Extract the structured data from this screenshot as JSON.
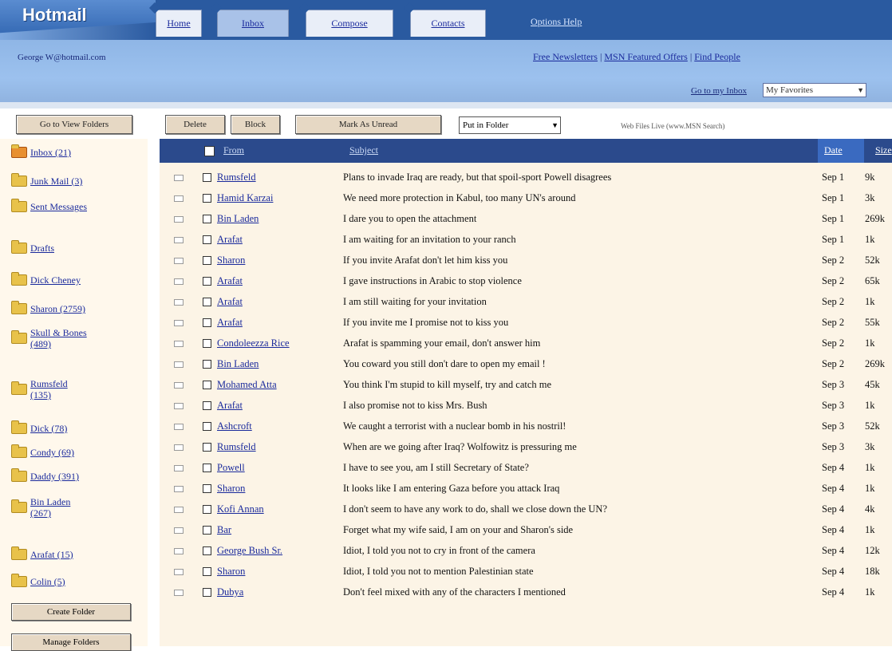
{
  "brand": {
    "logo": "Hotmail"
  },
  "tabs": [
    {
      "label": "Home"
    },
    {
      "label": "Inbox"
    },
    {
      "label": "Compose"
    },
    {
      "label": "Contacts"
    }
  ],
  "top_link": "Options Help",
  "account": {
    "email": "George W@hotmail.com",
    "links": [
      "Free Newsletters",
      "MSN Featured Offers",
      "Find People"
    ],
    "goto_label": "Go to my Inbox",
    "goto_value": "My Favorites"
  },
  "toolbar": {
    "view_folders": "Go to View Folders",
    "delete": "Delete",
    "block": "Block",
    "mark": "Mark As Unread",
    "put_in_folder": "Put in Folder",
    "promo": "Web Files Live (www.MSN Search)"
  },
  "sidebar": {
    "folders": [
      {
        "label": "Inbox (21)"
      },
      {
        "label": "Junk Mail (3)"
      },
      {
        "label": "Sent Messages"
      },
      {
        "label": "Drafts"
      },
      {
        "label": "Dick Cheney"
      },
      {
        "label": "Sharon (2759)"
      },
      {
        "label": "Skull & Bones (489)"
      },
      {
        "label": "Rumsfeld (135)"
      },
      {
        "label": "Dick (78)"
      },
      {
        "label": "Condy (69)"
      },
      {
        "label": "Daddy (391)"
      },
      {
        "label": "Bin Laden (267)"
      },
      {
        "label": "Arafat (15)"
      },
      {
        "label": "Colin (5)"
      }
    ],
    "create_folder": "Create Folder",
    "manage_folders": "Manage Folders"
  },
  "list": {
    "header": {
      "from": "From",
      "subject": "Subject",
      "date": "Date",
      "size": "Size"
    },
    "rows": [
      {
        "from": "Rumsfeld",
        "subject": "Plans to invade Iraq are ready, but that spoil-sport Powell disagrees",
        "date": "Sep 1",
        "size": "9k"
      },
      {
        "from": "Hamid Karzai",
        "subject": "We need more protection in Kabul, too many UN's around",
        "date": "Sep 1",
        "size": "3k"
      },
      {
        "from": "Bin Laden",
        "subject": "I dare you to open the attachment",
        "date": "Sep 1",
        "size": "269k"
      },
      {
        "from": "Arafat",
        "subject": "I am waiting for an invitation to your ranch",
        "date": "Sep 1",
        "size": "1k"
      },
      {
        "from": "Sharon",
        "subject": "If you invite Arafat don't let him kiss you",
        "date": "Sep 2",
        "size": "52k"
      },
      {
        "from": "Arafat",
        "subject": "I gave instructions in Arabic to stop violence",
        "date": "Sep 2",
        "size": "65k"
      },
      {
        "from": "Arafat",
        "subject": "I am still waiting for your invitation",
        "date": "Sep 2",
        "size": "1k"
      },
      {
        "from": "Arafat",
        "subject": "If you invite me I promise not to kiss you",
        "date": "Sep 2",
        "size": "55k"
      },
      {
        "from": "Condoleezza Rice",
        "subject": "Arafat is spamming your email, don't answer him",
        "date": "Sep 2",
        "size": "1k"
      },
      {
        "from": "Bin Laden",
        "subject": "You coward you still don't dare to open my email !",
        "date": "Sep 2",
        "size": "269k"
      },
      {
        "from": "Mohamed Atta",
        "subject": "You think I'm stupid to kill myself, try and catch me",
        "date": "Sep 3",
        "size": "45k"
      },
      {
        "from": "Arafat",
        "subject": "I also promise not to kiss Mrs. Bush",
        "date": "Sep 3",
        "size": "1k"
      },
      {
        "from": "Ashcroft",
        "subject": "We caught a terrorist with a nuclear bomb in his nostril!",
        "date": "Sep 3",
        "size": "52k"
      },
      {
        "from": "Rumsfeld",
        "subject": "When are we going after Iraq? Wolfowitz is pressuring me",
        "date": "Sep 3",
        "size": "3k"
      },
      {
        "from": "Powell",
        "subject": "I have to see you, am I still Secretary of State?",
        "date": "Sep 4",
        "size": "1k"
      },
      {
        "from": "Sharon",
        "subject": "It looks like I am entering Gaza before you attack Iraq",
        "date": "Sep 4",
        "size": "1k"
      },
      {
        "from": "Kofi Annan",
        "subject": "I don't seem to have any work to do, shall we close down the UN?",
        "date": "Sep 4",
        "size": "4k"
      },
      {
        "from": "Bar",
        "subject": "Forget what my wife said, I am on your and Sharon's side",
        "date": "Sep 4",
        "size": "1k"
      },
      {
        "from": "George Bush Sr.",
        "subject": "Idiot, I told you not to cry in front of the camera",
        "date": "Sep 4",
        "size": "12k"
      },
      {
        "from": "Sharon",
        "subject": "Idiot, I told you not to mention Palestinian state",
        "date": "Sep 4",
        "size": "18k"
      },
      {
        "from": "Dubya",
        "subject": "Don't feel mixed with any of the characters I mentioned",
        "date": "Sep 4",
        "size": "1k"
      }
    ]
  }
}
